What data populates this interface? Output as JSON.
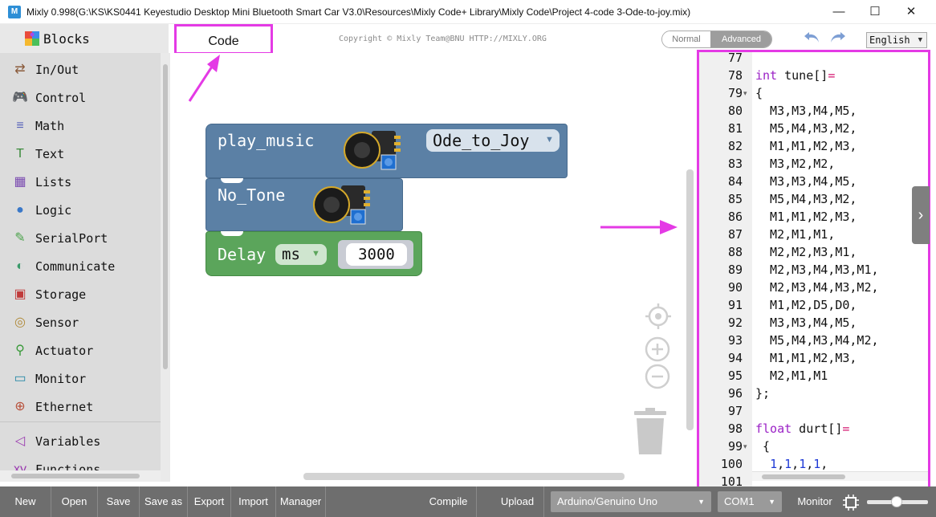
{
  "window": {
    "title": "Mixly 0.998(G:\\KS\\KS0441 Keyestudio Desktop Mini Bluetooth Smart Car V3.0\\Resources\\Mixly Code+ Library\\Mixly Code\\Project 4-code 3-Ode-to-joy.mix)",
    "app_icon_text": "M",
    "minimize": "—",
    "maximize": "☐",
    "close": "✕"
  },
  "header": {
    "blocks_tab": "Blocks",
    "code_tab": "Code",
    "copyright": "Copyright © Mixly Team@BNU HTTP://MIXLY.ORG",
    "mode_normal": "Normal",
    "mode_advanced": "Advanced",
    "language": "English"
  },
  "sidebar": {
    "categories": [
      {
        "label": "In/Out",
        "icon": "⇄",
        "color": "#8a5a3a",
        "icon_name": "inout-icon"
      },
      {
        "label": "Control",
        "icon": "🎮",
        "color": "#4a9a4a",
        "icon_name": "gamepad-icon"
      },
      {
        "label": "Math",
        "icon": "≡",
        "color": "#5560b8",
        "icon_name": "math-icon"
      },
      {
        "label": "Text",
        "icon": "T",
        "color": "#3a8a3a",
        "icon_name": "text-icon"
      },
      {
        "label": "Lists",
        "icon": "▦",
        "color": "#7a4ab0",
        "icon_name": "lists-icon"
      },
      {
        "label": "Logic",
        "icon": "●",
        "color": "#3a78c8",
        "icon_name": "bulb-icon"
      },
      {
        "label": "SerialPort",
        "icon": "✎",
        "color": "#4aa24a",
        "icon_name": "serial-icon"
      },
      {
        "label": "Communicate",
        "icon": "◐",
        "color": "#3a9a6a",
        "icon_name": "communicate-icon"
      },
      {
        "label": "Storage",
        "icon": "▣",
        "color": "#c03a3a",
        "icon_name": "storage-icon"
      },
      {
        "label": "Sensor",
        "icon": "◎",
        "color": "#b08a3a",
        "icon_name": "sensor-icon"
      },
      {
        "label": "Actuator",
        "icon": "⚲",
        "color": "#3a9a3a",
        "icon_name": "actuator-icon"
      },
      {
        "label": "Monitor",
        "icon": "▭",
        "color": "#2a8aa8",
        "icon_name": "monitor-icon"
      },
      {
        "label": "Ethernet",
        "icon": "⊕",
        "color": "#b8503a",
        "icon_name": "ethernet-icon"
      },
      {
        "label": "Variables",
        "icon": "◁",
        "color": "#9a3ab0",
        "icon_name": "variables-icon"
      },
      {
        "label": "Functions",
        "icon": "xy",
        "color": "#9a3ab0",
        "icon_name": "functions-icon"
      }
    ]
  },
  "blocks": {
    "play_music_label": "play_music",
    "song": "Ode_to_Joy",
    "no_tone_label": "No_Tone",
    "delay_label": "Delay",
    "delay_unit": "ms",
    "delay_value": "3000",
    "dropdown_arrow": "▼"
  },
  "code": {
    "lines": [
      {
        "n": "77",
        "fold": "",
        "parts": []
      },
      {
        "n": "78",
        "fold": "",
        "parts": [
          {
            "t": "int",
            "c": "kw"
          },
          {
            "t": " tune[]",
            "c": ""
          },
          {
            "t": "=",
            "c": "punct"
          }
        ]
      },
      {
        "n": "79",
        "fold": "▾",
        "parts": [
          {
            "t": "{",
            "c": ""
          }
        ]
      },
      {
        "n": "80",
        "fold": "",
        "parts": [
          {
            "t": "  M3,M3,M4,M5,",
            "c": ""
          }
        ]
      },
      {
        "n": "81",
        "fold": "",
        "parts": [
          {
            "t": "  M5,M4,M3,M2,",
            "c": ""
          }
        ]
      },
      {
        "n": "82",
        "fold": "",
        "parts": [
          {
            "t": "  M1,M1,M2,M3,",
            "c": ""
          }
        ]
      },
      {
        "n": "83",
        "fold": "",
        "parts": [
          {
            "t": "  M3,M2,M2,",
            "c": ""
          }
        ]
      },
      {
        "n": "84",
        "fold": "",
        "parts": [
          {
            "t": "  M3,M3,M4,M5,",
            "c": ""
          }
        ]
      },
      {
        "n": "85",
        "fold": "",
        "parts": [
          {
            "t": "  M5,M4,M3,M2,",
            "c": ""
          }
        ]
      },
      {
        "n": "86",
        "fold": "",
        "parts": [
          {
            "t": "  M1,M1,M2,M3,",
            "c": ""
          }
        ]
      },
      {
        "n": "87",
        "fold": "",
        "parts": [
          {
            "t": "  M2,M1,M1,",
            "c": ""
          }
        ]
      },
      {
        "n": "88",
        "fold": "",
        "parts": [
          {
            "t": "  M2,M2,M3,M1,",
            "c": ""
          }
        ]
      },
      {
        "n": "89",
        "fold": "",
        "parts": [
          {
            "t": "  M2,M3,M4,M3,M1,",
            "c": ""
          }
        ]
      },
      {
        "n": "90",
        "fold": "",
        "parts": [
          {
            "t": "  M2,M3,M4,M3,M2,",
            "c": ""
          }
        ]
      },
      {
        "n": "91",
        "fold": "",
        "parts": [
          {
            "t": "  M1,M2,D5,D0,",
            "c": ""
          }
        ]
      },
      {
        "n": "92",
        "fold": "",
        "parts": [
          {
            "t": "  M3,M3,M4,M5,",
            "c": ""
          }
        ]
      },
      {
        "n": "93",
        "fold": "",
        "parts": [
          {
            "t": "  M5,M4,M3,M4,M2,",
            "c": ""
          }
        ]
      },
      {
        "n": "94",
        "fold": "",
        "parts": [
          {
            "t": "  M1,M1,M2,M3,",
            "c": ""
          }
        ]
      },
      {
        "n": "95",
        "fold": "",
        "parts": [
          {
            "t": "  M2,M1,M1",
            "c": ""
          }
        ]
      },
      {
        "n": "96",
        "fold": "",
        "parts": [
          {
            "t": "};",
            "c": ""
          }
        ]
      },
      {
        "n": "97",
        "fold": "",
        "parts": []
      },
      {
        "n": "98",
        "fold": "",
        "parts": [
          {
            "t": "float",
            "c": "kw"
          },
          {
            "t": " durt[]",
            "c": ""
          },
          {
            "t": "=",
            "c": "punct"
          }
        ]
      },
      {
        "n": "99",
        "fold": "▾",
        "parts": [
          {
            "t": " {",
            "c": ""
          }
        ]
      },
      {
        "n": "100",
        "fold": "",
        "parts": [
          {
            "t": "  ",
            "c": ""
          },
          {
            "t": "1",
            "c": "num"
          },
          {
            "t": ",",
            "c": ""
          },
          {
            "t": "1",
            "c": "num"
          },
          {
            "t": ",",
            "c": ""
          },
          {
            "t": "1",
            "c": "num"
          },
          {
            "t": ",",
            "c": ""
          },
          {
            "t": "1",
            "c": "num"
          },
          {
            "t": ",",
            "c": ""
          }
        ]
      },
      {
        "n": "101",
        "fold": "",
        "parts": []
      }
    ],
    "panel_toggle": "›"
  },
  "toolbar": {
    "buttons": [
      {
        "label": "New",
        "name": "new-button"
      },
      {
        "label": "Open",
        "name": "open-button"
      },
      {
        "label": "Save",
        "name": "save-button"
      },
      {
        "label": "Save as",
        "name": "save-as-button"
      },
      {
        "label": "Export",
        "name": "export-button"
      },
      {
        "label": "Import",
        "name": "import-button"
      },
      {
        "label": "Manager",
        "name": "manager-button"
      },
      {
        "label": "Compile",
        "name": "compile-button"
      },
      {
        "label": "Upload",
        "name": "upload-button"
      }
    ],
    "board": "Arduino/Genuino Uno",
    "port": "COM1",
    "monitor": "Monitor",
    "select_arrow": "▼"
  }
}
